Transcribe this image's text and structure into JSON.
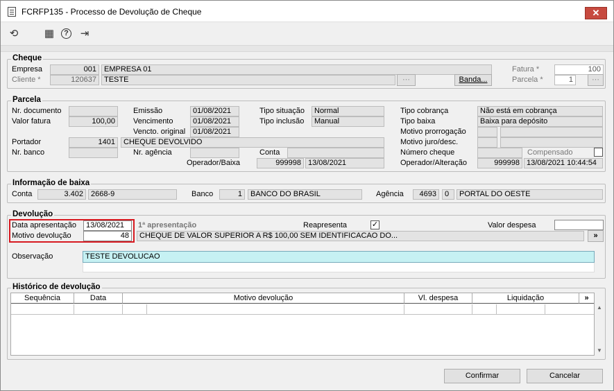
{
  "window": {
    "title": "FCRFP135 - Processo de Devolução de Cheque",
    "close_glyph": "✕"
  },
  "toolbar": {
    "refresh_glyph": "⟲",
    "calendar_glyph": "▦",
    "help_glyph": "?",
    "exit_glyph": "⇥"
  },
  "cheque": {
    "title": "Cheque",
    "empresa_label": "Empresa",
    "empresa_code": "001",
    "empresa_name": "EMPRESA 01",
    "cliente_label": "Cliente *",
    "cliente_code": "120637",
    "cliente_name": "TESTE",
    "fatura_label": "Fatura *",
    "fatura_value": "100",
    "parcela_label": "Parcela *",
    "parcela_value": "1",
    "banda_label": "Banda..."
  },
  "parcela": {
    "title": "Parcela",
    "nr_doc_label": "Nr. documento",
    "nr_doc_value": "",
    "valor_fatura_label": "Valor fatura",
    "valor_fatura_value": "100,00",
    "emissao_label": "Emissão",
    "emissao_value": "01/08/2021",
    "vencimento_label": "Vencimento",
    "vencimento_value": "01/08/2021",
    "vencto_original_label": "Vencto. original",
    "vencto_original_value": "01/08/2021",
    "tipo_situacao_label": "Tipo situação",
    "tipo_situacao_value": "Normal",
    "tipo_inclusao_label": "Tipo inclusão",
    "tipo_inclusao_value": "Manual",
    "tipo_cobranca_label": "Tipo cobrança",
    "tipo_cobranca_value": "Não está em cobrança",
    "tipo_baixa_label": "Tipo baixa",
    "tipo_baixa_value": "Baixa para depósito",
    "motivo_prorrogacao_label": "Motivo prorrogação",
    "motivo_juro_label": "Motivo juro/desc.",
    "portador_label": "Portador",
    "portador_code": "1401",
    "portador_name": "CHEQUE DEVOLVIDO",
    "nr_banco_label": "Nr. banco",
    "nr_agencia_label": "Nr. agência",
    "conta_label": "Conta",
    "numero_cheque_label": "Número cheque",
    "compensado_label": "Compensado",
    "operador_baixa_label": "Operador/Baixa",
    "operador_baixa_code": "999998",
    "operador_baixa_date": "13/08/2021",
    "operador_alteracao_label": "Operador/Alteração",
    "operador_alteracao_code": "999998",
    "operador_alteracao_date": "13/08/2021 10:44:54"
  },
  "baixa": {
    "title": "Informação de baixa",
    "conta_label": "Conta",
    "conta_code": "3.402",
    "conta_number": "2668-9",
    "banco_label": "Banco",
    "banco_code": "1",
    "banco_name": "BANCO DO BRASIL",
    "agencia_label": "Agência",
    "agencia_code": "4693",
    "agencia_digit": "0",
    "agencia_name": "PORTAL DO OESTE"
  },
  "devolucao": {
    "title": "Devolução",
    "data_label": "Data apresentação",
    "data_value": "13/08/2021",
    "primeira_label": "1ª apresentação",
    "reapresenta_label": "Reapresenta",
    "reapresenta_checked": "✓",
    "valor_despesa_label": "Valor despesa",
    "motivo_label": "Motivo devolução",
    "motivo_code": "48",
    "motivo_text": "CHEQUE DE VALOR SUPERIOR A R$ 100,00 SEM IDENTIFICACAO DO...",
    "motivo_btn": "»",
    "observacao_label": "Observação",
    "observacao_value": "TESTE DEVOLUCAO"
  },
  "historico": {
    "title": "Histórico de devolução",
    "columns": [
      "Sequência",
      "Data",
      "Motivo devolução",
      "Vl. despesa",
      "Liquidação"
    ],
    "expand_btn": "»"
  },
  "footer": {
    "confirm_label": "Confirmar",
    "cancel_label": "Cancelar"
  }
}
